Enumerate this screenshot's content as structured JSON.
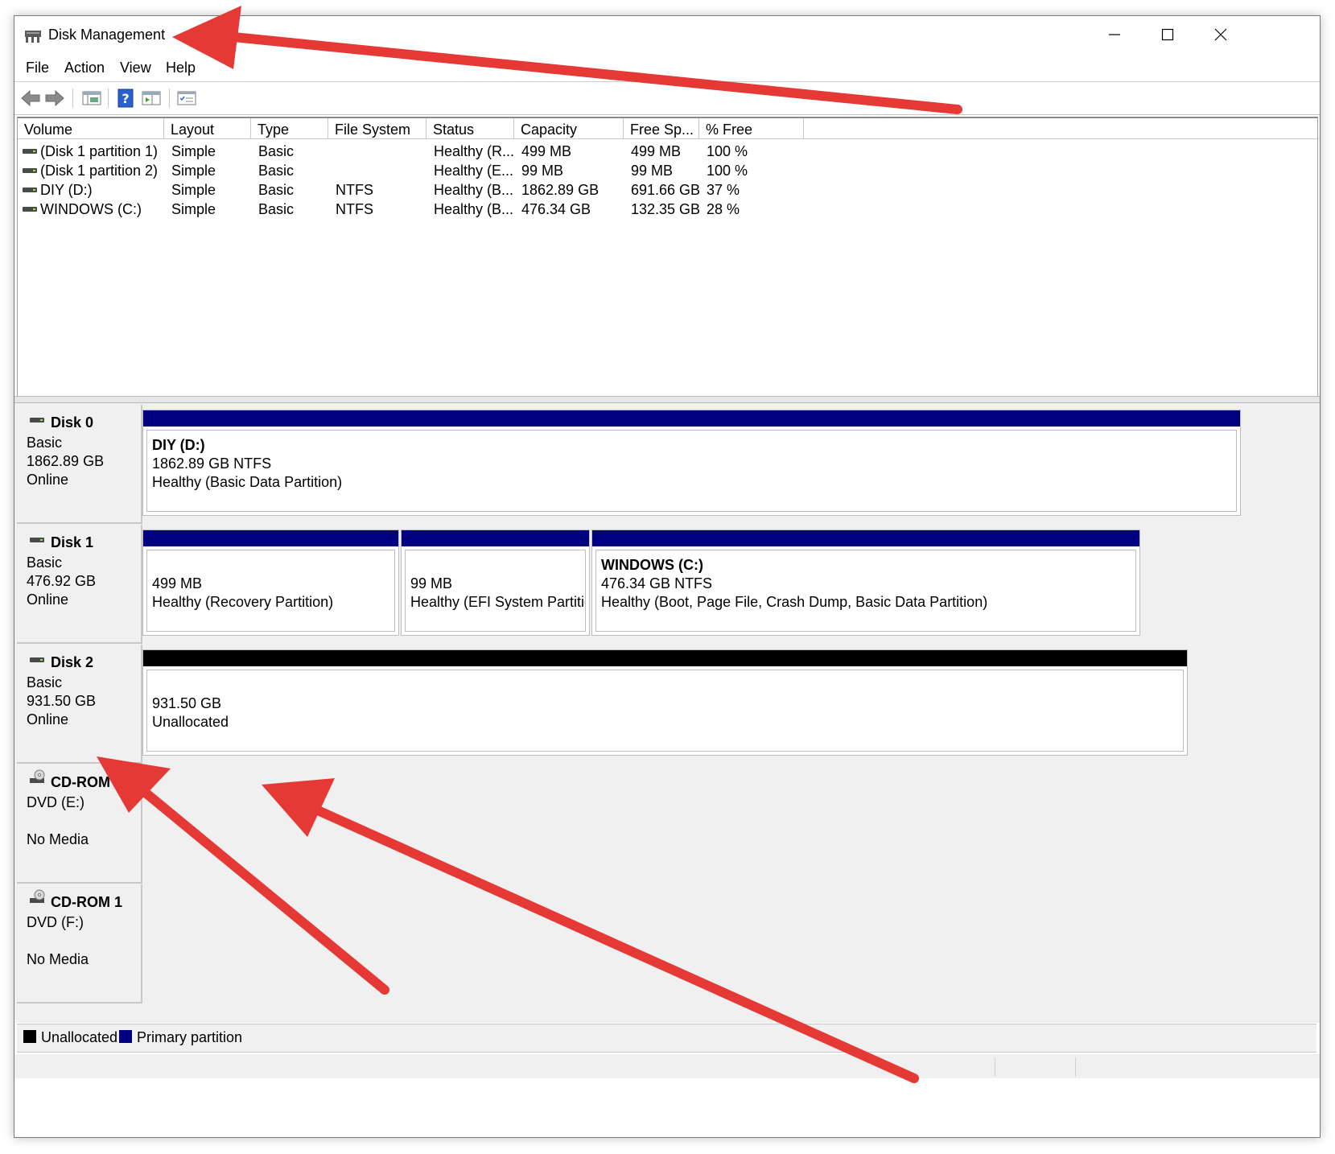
{
  "window": {
    "title": "Disk Management"
  },
  "menu": {
    "items": [
      "File",
      "Action",
      "View",
      "Help"
    ]
  },
  "toolbar": {
    "icons": [
      "back-arrow-icon",
      "forward-arrow-icon",
      "disk-list-icon",
      "help-icon",
      "properties-icon",
      "checklist-icon"
    ]
  },
  "volume_list": {
    "columns": [
      "Volume",
      "Layout",
      "Type",
      "File System",
      "Status",
      "Capacity",
      "Free Sp...",
      "% Free"
    ],
    "rows": [
      {
        "volume": "(Disk 1 partition 1)",
        "layout": "Simple",
        "type": "Basic",
        "fs": "",
        "status": "Healthy (R...",
        "capacity": "499 MB",
        "free": "499 MB",
        "pct": "100 %"
      },
      {
        "volume": "(Disk 1 partition 2)",
        "layout": "Simple",
        "type": "Basic",
        "fs": "",
        "status": "Healthy (E...",
        "capacity": "99 MB",
        "free": "99 MB",
        "pct": "100 %"
      },
      {
        "volume": "DIY (D:)",
        "layout": "Simple",
        "type": "Basic",
        "fs": "NTFS",
        "status": "Healthy (B...",
        "capacity": "1862.89 GB",
        "free": "691.66 GB",
        "pct": "37 %"
      },
      {
        "volume": "WINDOWS (C:)",
        "layout": "Simple",
        "type": "Basic",
        "fs": "NTFS",
        "status": "Healthy (B...",
        "capacity": "476.34 GB",
        "free": "132.35 GB",
        "pct": "28 %"
      }
    ]
  },
  "disks": [
    {
      "name": "Disk 0",
      "kind": "Basic",
      "size": "1862.89 GB",
      "state": "Online",
      "partitions": [
        {
          "title": "DIY  (D:)",
          "line1": "1862.89 GB NTFS",
          "line2": "Healthy (Basic Data Partition)"
        }
      ]
    },
    {
      "name": "Disk 1",
      "kind": "Basic",
      "size": "476.92 GB",
      "state": "Online",
      "partitions": [
        {
          "title": "",
          "line1": "499 MB",
          "line2": "Healthy (Recovery Partition)"
        },
        {
          "title": "",
          "line1": "99 MB",
          "line2": "Healthy (EFI System Partition)"
        },
        {
          "title": "WINDOWS  (C:)",
          "line1": "476.34 GB NTFS",
          "line2": "Healthy (Boot, Page File, Crash Dump, Basic Data Partition)"
        }
      ]
    },
    {
      "name": "Disk 2",
      "kind": "Basic",
      "size": "931.50 GB",
      "state": "Online",
      "partitions": [
        {
          "title": "",
          "line1": "931.50 GB",
          "line2": "Unallocated"
        }
      ]
    },
    {
      "name": "CD-ROM 0",
      "kind": "DVD (E:)",
      "size": "",
      "state": "No Media",
      "partitions": []
    },
    {
      "name": "CD-ROM 1",
      "kind": "DVD (F:)",
      "size": "",
      "state": "No Media",
      "partitions": []
    }
  ],
  "legend": {
    "unallocated": "Unallocated",
    "primary": "Primary partition"
  },
  "colors": {
    "primary_partition": "#000080",
    "unallocated": "#000000",
    "annotation_arrow": "#e53935"
  }
}
